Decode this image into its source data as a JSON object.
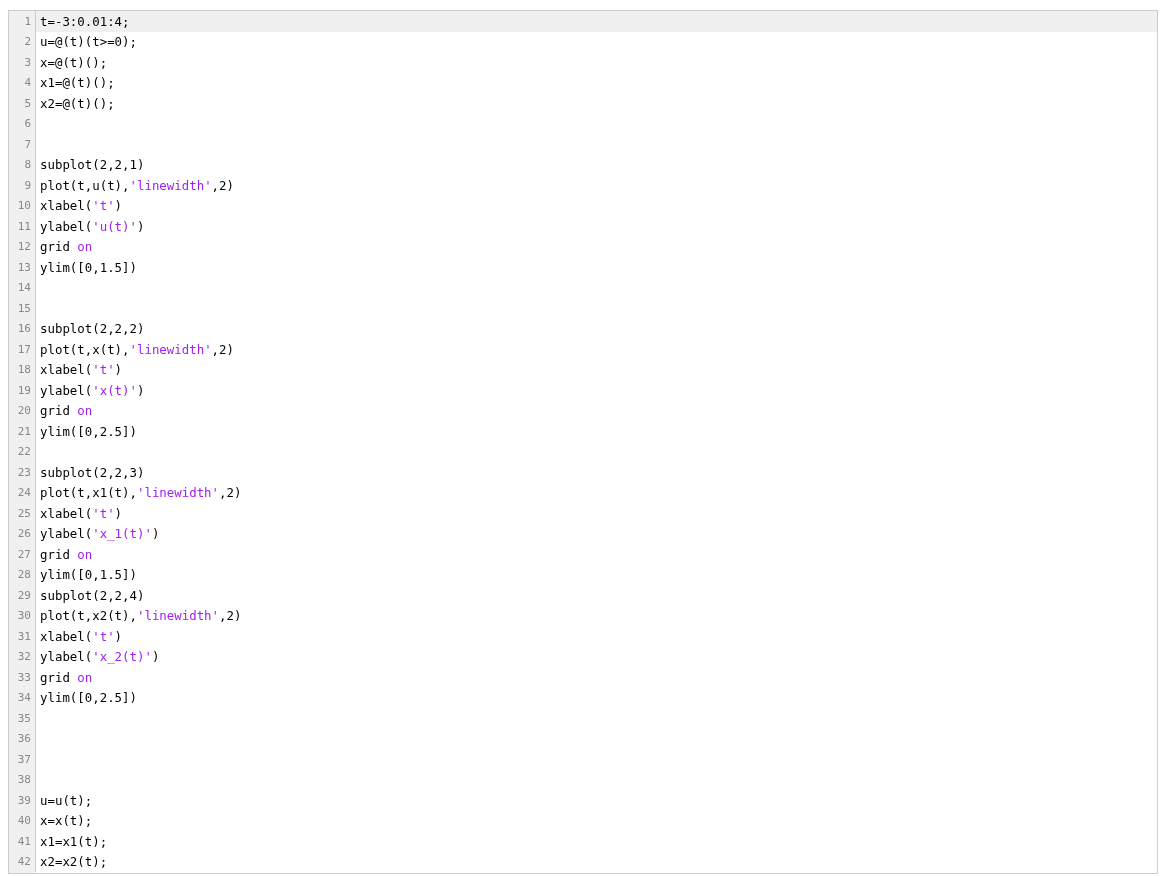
{
  "editor": {
    "lines": [
      {
        "number": "1",
        "current": true,
        "tokens": [
          {
            "kind": "plain",
            "text": "t=-3:0.01:4;"
          }
        ]
      },
      {
        "number": "2",
        "current": false,
        "tokens": [
          {
            "kind": "plain",
            "text": "u=@(t)(t>=0);"
          }
        ]
      },
      {
        "number": "3",
        "current": false,
        "tokens": [
          {
            "kind": "plain",
            "text": "x=@(t)();"
          }
        ]
      },
      {
        "number": "4",
        "current": false,
        "tokens": [
          {
            "kind": "plain",
            "text": "x1=@(t)();"
          }
        ]
      },
      {
        "number": "5",
        "current": false,
        "tokens": [
          {
            "kind": "plain",
            "text": "x2=@(t)();"
          }
        ]
      },
      {
        "number": "6",
        "current": false
      },
      {
        "number": "7",
        "current": false
      },
      {
        "number": "8",
        "current": false,
        "tokens": [
          {
            "kind": "plain",
            "text": "subplot(2,2,1)"
          }
        ]
      },
      {
        "number": "9",
        "current": false,
        "tokens": [
          {
            "kind": "plain",
            "text": "plot(t,u(t),"
          },
          {
            "kind": "string",
            "text": "'linewidth'"
          },
          {
            "kind": "plain",
            "text": ",2)"
          }
        ]
      },
      {
        "number": "10",
        "current": false,
        "tokens": [
          {
            "kind": "plain",
            "text": "xlabel("
          },
          {
            "kind": "string",
            "text": "'t'"
          },
          {
            "kind": "plain",
            "text": ")"
          }
        ]
      },
      {
        "number": "11",
        "current": false,
        "tokens": [
          {
            "kind": "plain",
            "text": "ylabel("
          },
          {
            "kind": "string",
            "text": "'u(t)'"
          },
          {
            "kind": "plain",
            "text": ")"
          }
        ]
      },
      {
        "number": "12",
        "current": false,
        "tokens": [
          {
            "kind": "plain",
            "text": "grid "
          },
          {
            "kind": "keyword",
            "text": "on"
          }
        ]
      },
      {
        "number": "13",
        "current": false,
        "tokens": [
          {
            "kind": "plain",
            "text": "ylim([0,1.5])"
          }
        ]
      },
      {
        "number": "14",
        "current": false
      },
      {
        "number": "15",
        "current": false
      },
      {
        "number": "16",
        "current": false,
        "tokens": [
          {
            "kind": "plain",
            "text": "subplot(2,2,2)"
          }
        ]
      },
      {
        "number": "17",
        "current": false,
        "tokens": [
          {
            "kind": "plain",
            "text": "plot(t,x(t),"
          },
          {
            "kind": "string",
            "text": "'linewidth'"
          },
          {
            "kind": "plain",
            "text": ",2)"
          }
        ]
      },
      {
        "number": "18",
        "current": false,
        "tokens": [
          {
            "kind": "plain",
            "text": "xlabel("
          },
          {
            "kind": "string",
            "text": "'t'"
          },
          {
            "kind": "plain",
            "text": ")"
          }
        ]
      },
      {
        "number": "19",
        "current": false,
        "tokens": [
          {
            "kind": "plain",
            "text": "ylabel("
          },
          {
            "kind": "string",
            "text": "'x(t)'"
          },
          {
            "kind": "plain",
            "text": ")"
          }
        ]
      },
      {
        "number": "20",
        "current": false,
        "tokens": [
          {
            "kind": "plain",
            "text": "grid "
          },
          {
            "kind": "keyword",
            "text": "on"
          }
        ]
      },
      {
        "number": "21",
        "current": false,
        "tokens": [
          {
            "kind": "plain",
            "text": "ylim([0,2.5])"
          }
        ]
      },
      {
        "number": "22",
        "current": false
      },
      {
        "number": "23",
        "current": false,
        "tokens": [
          {
            "kind": "plain",
            "text": "subplot(2,2,3)"
          }
        ]
      },
      {
        "number": "24",
        "current": false,
        "tokens": [
          {
            "kind": "plain",
            "text": "plot(t,x1(t),"
          },
          {
            "kind": "string",
            "text": "'linewidth'"
          },
          {
            "kind": "plain",
            "text": ",2)"
          }
        ]
      },
      {
        "number": "25",
        "current": false,
        "tokens": [
          {
            "kind": "plain",
            "text": "xlabel("
          },
          {
            "kind": "string",
            "text": "'t'"
          },
          {
            "kind": "plain",
            "text": ")"
          }
        ]
      },
      {
        "number": "26",
        "current": false,
        "tokens": [
          {
            "kind": "plain",
            "text": "ylabel("
          },
          {
            "kind": "string",
            "text": "'x_1(t)'"
          },
          {
            "kind": "plain",
            "text": ")"
          }
        ]
      },
      {
        "number": "27",
        "current": false,
        "tokens": [
          {
            "kind": "plain",
            "text": "grid "
          },
          {
            "kind": "keyword",
            "text": "on"
          }
        ]
      },
      {
        "number": "28",
        "current": false,
        "tokens": [
          {
            "kind": "plain",
            "text": "ylim([0,1.5])"
          }
        ]
      },
      {
        "number": "29",
        "current": false,
        "tokens": [
          {
            "kind": "plain",
            "text": "subplot(2,2,4)"
          }
        ]
      },
      {
        "number": "30",
        "current": false,
        "tokens": [
          {
            "kind": "plain",
            "text": "plot(t,x2(t),"
          },
          {
            "kind": "string",
            "text": "'linewidth'"
          },
          {
            "kind": "plain",
            "text": ",2)"
          }
        ]
      },
      {
        "number": "31",
        "current": false,
        "tokens": [
          {
            "kind": "plain",
            "text": "xlabel("
          },
          {
            "kind": "string",
            "text": "'t'"
          },
          {
            "kind": "plain",
            "text": ")"
          }
        ]
      },
      {
        "number": "32",
        "current": false,
        "tokens": [
          {
            "kind": "plain",
            "text": "ylabel("
          },
          {
            "kind": "string",
            "text": "'x_2(t)'"
          },
          {
            "kind": "plain",
            "text": ")"
          }
        ]
      },
      {
        "number": "33",
        "current": false,
        "tokens": [
          {
            "kind": "plain",
            "text": "grid "
          },
          {
            "kind": "keyword",
            "text": "on"
          }
        ]
      },
      {
        "number": "34",
        "current": false,
        "tokens": [
          {
            "kind": "plain",
            "text": "ylim([0,2.5])"
          }
        ]
      },
      {
        "number": "35",
        "current": false
      },
      {
        "number": "36",
        "current": false
      },
      {
        "number": "37",
        "current": false
      },
      {
        "number": "38",
        "current": false
      },
      {
        "number": "39",
        "current": false,
        "tokens": [
          {
            "kind": "plain",
            "text": "u=u(t);"
          }
        ]
      },
      {
        "number": "40",
        "current": false,
        "tokens": [
          {
            "kind": "plain",
            "text": "x=x(t);"
          }
        ]
      },
      {
        "number": "41",
        "current": false,
        "tokens": [
          {
            "kind": "plain",
            "text": "x1=x1(t);"
          }
        ]
      },
      {
        "number": "42",
        "current": false,
        "tokens": [
          {
            "kind": "plain",
            "text": "x2=x2(t);"
          }
        ]
      }
    ]
  }
}
